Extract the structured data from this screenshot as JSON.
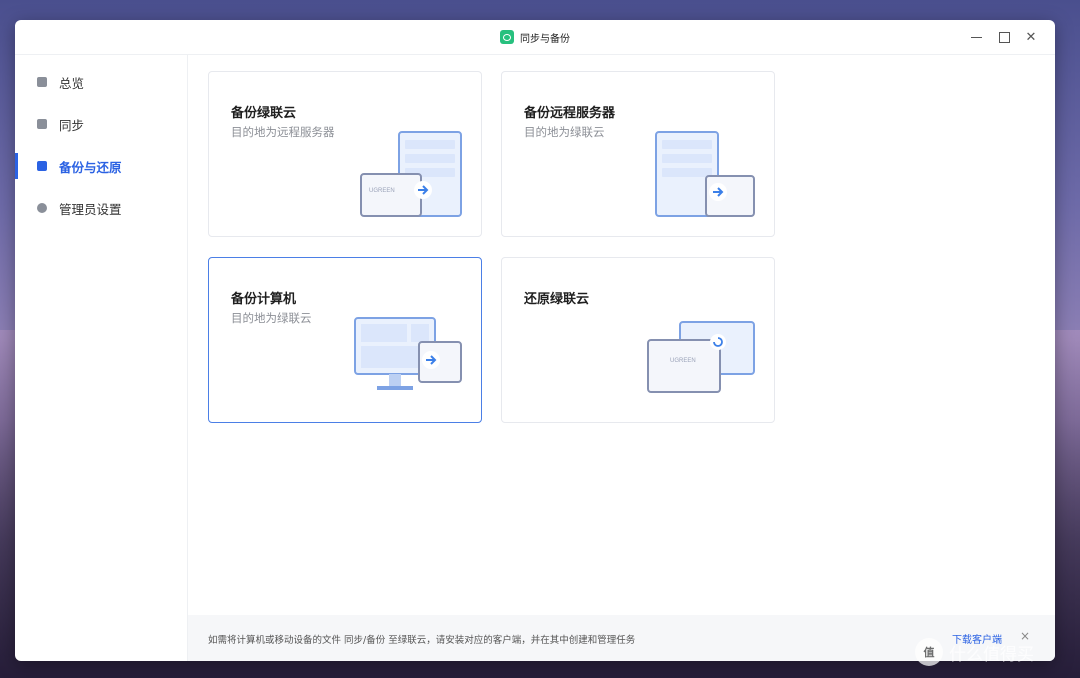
{
  "window": {
    "title": "同步与备份"
  },
  "sidebar": {
    "items": [
      {
        "label": "总览"
      },
      {
        "label": "同步"
      },
      {
        "label": "备份与还原",
        "active": true
      },
      {
        "label": "管理员设置"
      }
    ]
  },
  "cards": [
    {
      "title": "备份绿联云",
      "subtitle": "目的地为远程服务器"
    },
    {
      "title": "备份远程服务器",
      "subtitle": "目的地为绿联云"
    },
    {
      "title": "备份计算机",
      "subtitle": "目的地为绿联云"
    },
    {
      "title": "还原绿联云",
      "subtitle": ""
    }
  ],
  "illustration": {
    "brand_label": "UGREEN"
  },
  "footer": {
    "message": "如需将计算机或移动设备的文件 同步/备份 至绿联云，请安装对应的客户端，并在其中创建和管理任务",
    "link": "下载客户端",
    "close": "×"
  },
  "watermark": {
    "text": "什么值得买",
    "badge": "值"
  },
  "colors": {
    "accent": "#2b62e3",
    "app_icon": "#27c07e"
  }
}
